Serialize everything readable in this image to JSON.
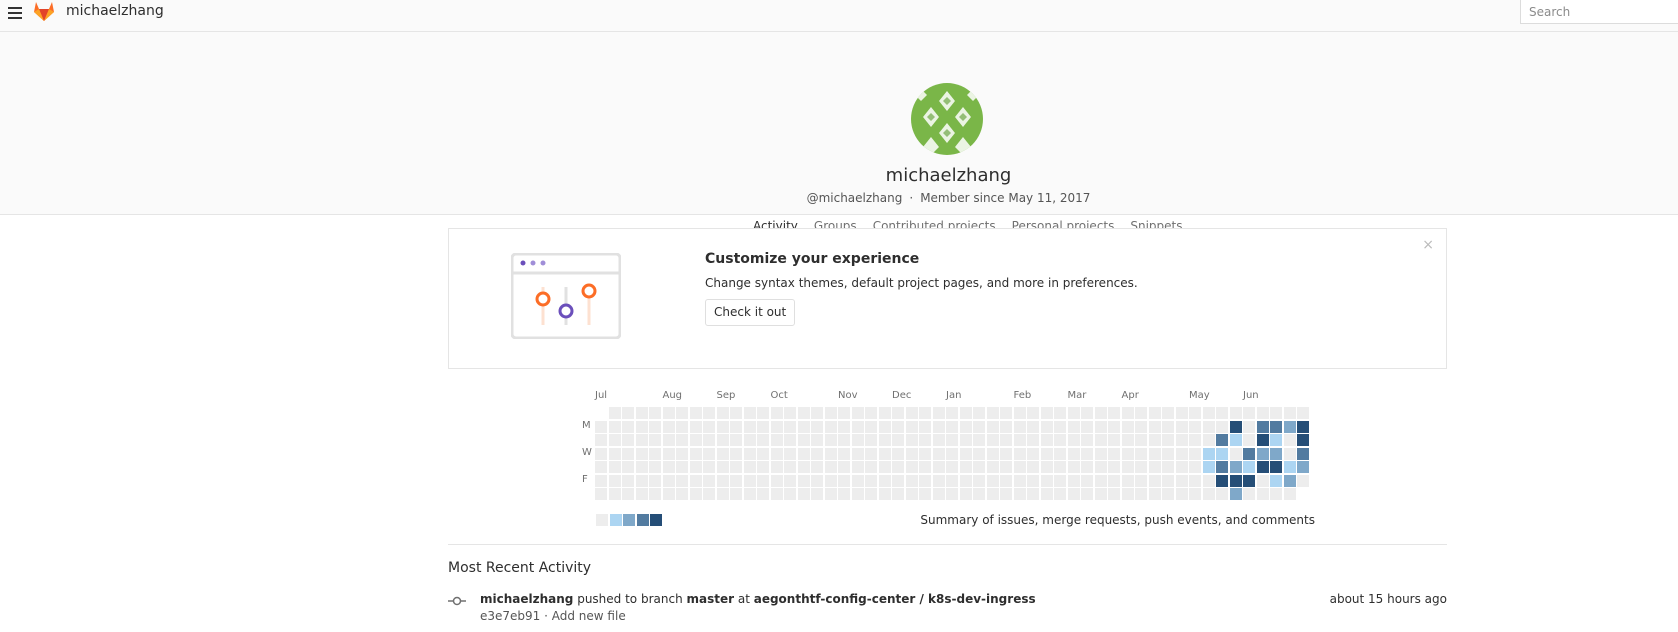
{
  "nav": {
    "brand": "michaelzhang",
    "search_placeholder": "Search",
    "brand_color": "#e24329"
  },
  "profile": {
    "name": "michaelzhang",
    "handle": "@michaelzhang",
    "separator": "·",
    "member_since": "Member since May 11, 2017",
    "tabs": [
      {
        "label": "Activity",
        "active": true
      },
      {
        "label": "Groups",
        "active": false
      },
      {
        "label": "Contributed projects",
        "active": false
      },
      {
        "label": "Personal projects",
        "active": false
      },
      {
        "label": "Snippets",
        "active": false
      }
    ],
    "avatar_color": "#7ab648"
  },
  "callout": {
    "title": "Customize your experience",
    "description": "Change syntax themes, default project pages, and more in preferences.",
    "button": "Check it out",
    "close": "×"
  },
  "calendar": {
    "months": [
      "Jul",
      "Aug",
      "Sep",
      "Oct",
      "Nov",
      "Dec",
      "Jan",
      "Feb",
      "Mar",
      "Apr",
      "May",
      "Jun"
    ],
    "day_labels": [
      "M",
      "W",
      "F"
    ],
    "summary": "Summary of issues, merge requests, push events, and comments",
    "colors": [
      "#ededed",
      "#acd5f2",
      "#7fa8c9",
      "#527ba0",
      "#254e77"
    ]
  },
  "activity": {
    "title": "Most Recent Activity",
    "events": [
      {
        "author": "michaelzhang",
        "action": " pushed to branch ",
        "branch": "master",
        "at": " at ",
        "project": "aegonthtf-config-center / k8s-dev-ingress",
        "time": "about 15 hours ago",
        "commit": "e3e7eb91",
        "message": " · Add new file"
      }
    ]
  }
}
